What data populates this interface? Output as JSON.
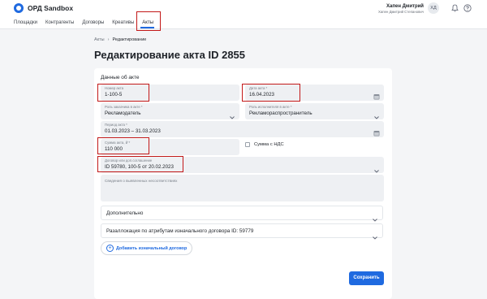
{
  "app": {
    "title": "ОРД Sandbox"
  },
  "nav": {
    "items": [
      {
        "label": "Площадки"
      },
      {
        "label": "Контрагенты"
      },
      {
        "label": "Договоры"
      },
      {
        "label": "Креативы"
      },
      {
        "label": "Акты"
      }
    ],
    "active": "Акты"
  },
  "user": {
    "name": "Хапен Дмитрий",
    "subtitle": "Хапен Дмитрий Степанович",
    "initials": "ХД"
  },
  "icons": {
    "notifications": "bell-icon",
    "help": "question-icon"
  },
  "breadcrumb": {
    "parent": "Акты",
    "separator": "›",
    "current": "Редактирование"
  },
  "page": {
    "title": "Редактирование акта ID 2855"
  },
  "form": {
    "section_title": "Данные об акте",
    "act_number": {
      "label": "Номер акта",
      "value": "1-100-5"
    },
    "act_date": {
      "label": "Дата акта *",
      "value": "16.04.2023"
    },
    "customer_role": {
      "label": "Роль заказчика в акте *",
      "value": "Рекламодатель"
    },
    "executor_role": {
      "label": "Роль исполнителя в акте *",
      "value": "Рекламораспространитель"
    },
    "period": {
      "label": "Период акта *",
      "value": "01.03.2023 – 31.03.2023"
    },
    "amount": {
      "label": "Сумма акта, ₽ *",
      "value": "110 000"
    },
    "vat": {
      "label": "Сумма с НДС",
      "checked": false
    },
    "contract": {
      "label": "Договор или доп.соглашение",
      "value": "ID 59780, 100-5 от 20.02.2023"
    },
    "discrepancies": {
      "placeholder": "Сведения о выявленных несоответствиях"
    }
  },
  "sections": {
    "additional": "Дополнительно",
    "allocation": "Разаллокация по атрибутам изначального договора ID: 59779"
  },
  "buttons": {
    "add_contract": "Добавить изначальный договор",
    "save": "Сохранить"
  },
  "colors": {
    "accent": "#1f6ae0",
    "highlight": "#c21818"
  }
}
